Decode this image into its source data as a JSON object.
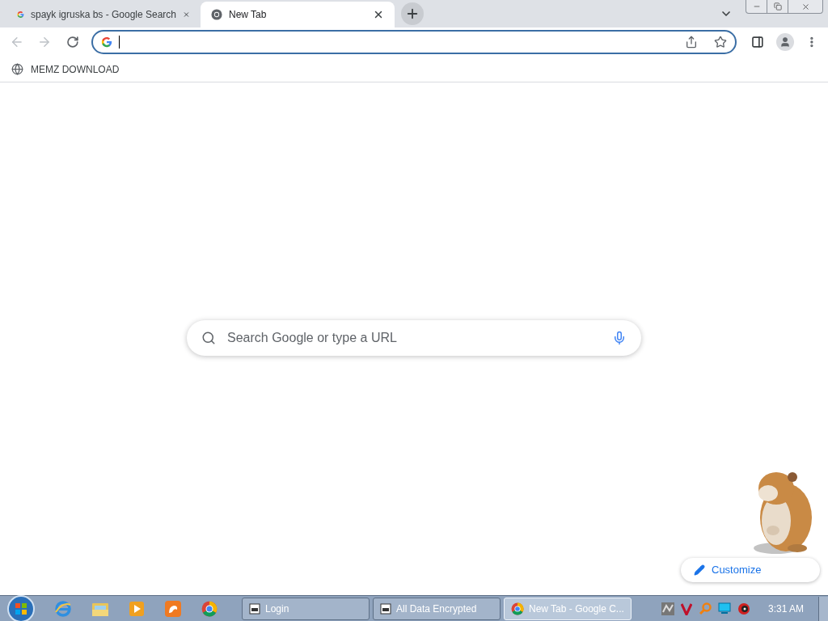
{
  "tabs": [
    {
      "title": "spayk igruska bs - Google Search",
      "selected": false
    },
    {
      "title": "New Tab",
      "selected": true
    }
  ],
  "bookmarks": [
    {
      "label": "MEMZ DOWNLOAD"
    }
  ],
  "search": {
    "placeholder": "Search Google or type a URL"
  },
  "customize": {
    "label": "Customize"
  },
  "taskbar": {
    "windows": [
      {
        "label": "Login",
        "selected": false
      },
      {
        "label": "All Data Encrypted",
        "selected": false
      },
      {
        "label": "New Tab - Google C...",
        "selected": true
      }
    ],
    "clock": "3:31 AM"
  }
}
